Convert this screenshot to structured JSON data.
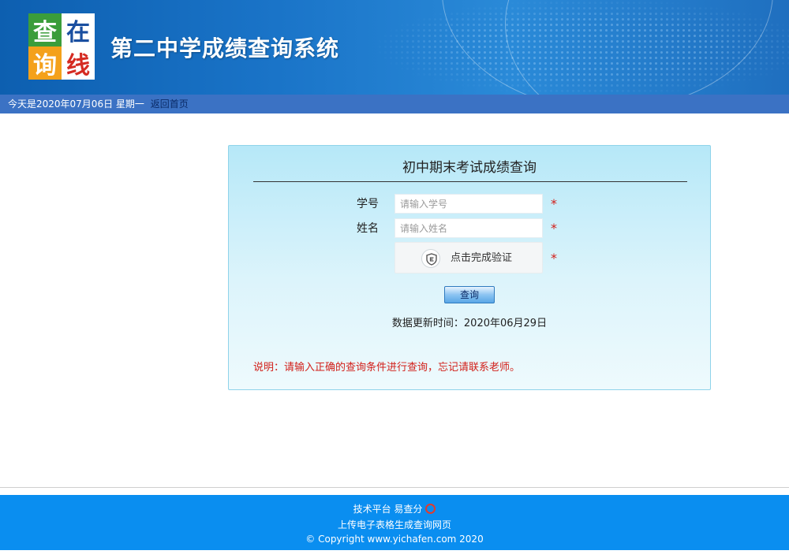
{
  "header": {
    "logo_chars": [
      "查",
      "在",
      "询",
      "线"
    ],
    "title": "第二中学成绩查询系统"
  },
  "datebar": {
    "today": "今天是2020年07月06日  星期一",
    "home_link": "返回首页"
  },
  "panel": {
    "title": "初中期末考试成绩查询",
    "fields": [
      {
        "label": "学号",
        "placeholder": "请输入学号"
      },
      {
        "label": "姓名",
        "placeholder": "请输入姓名"
      }
    ],
    "required_mark": "*",
    "captcha_text": "点击完成验证",
    "submit_label": "查询",
    "update_text": "数据更新时间：2020年06月29日",
    "note": "说明：请输入正确的查询条件进行查询，忘记请联系老师。"
  },
  "footer": {
    "line1": "技术平台  易查分",
    "line2": "上传电子表格生成查询网页",
    "line3": "© Copyright www.yichafen.com 2020"
  },
  "colors": {
    "banner": "#1a74c8",
    "datebar": "#3b72c4",
    "panel_bg": "#c8eef9",
    "required": "#d2201a",
    "footer": "#0a8ef0"
  }
}
